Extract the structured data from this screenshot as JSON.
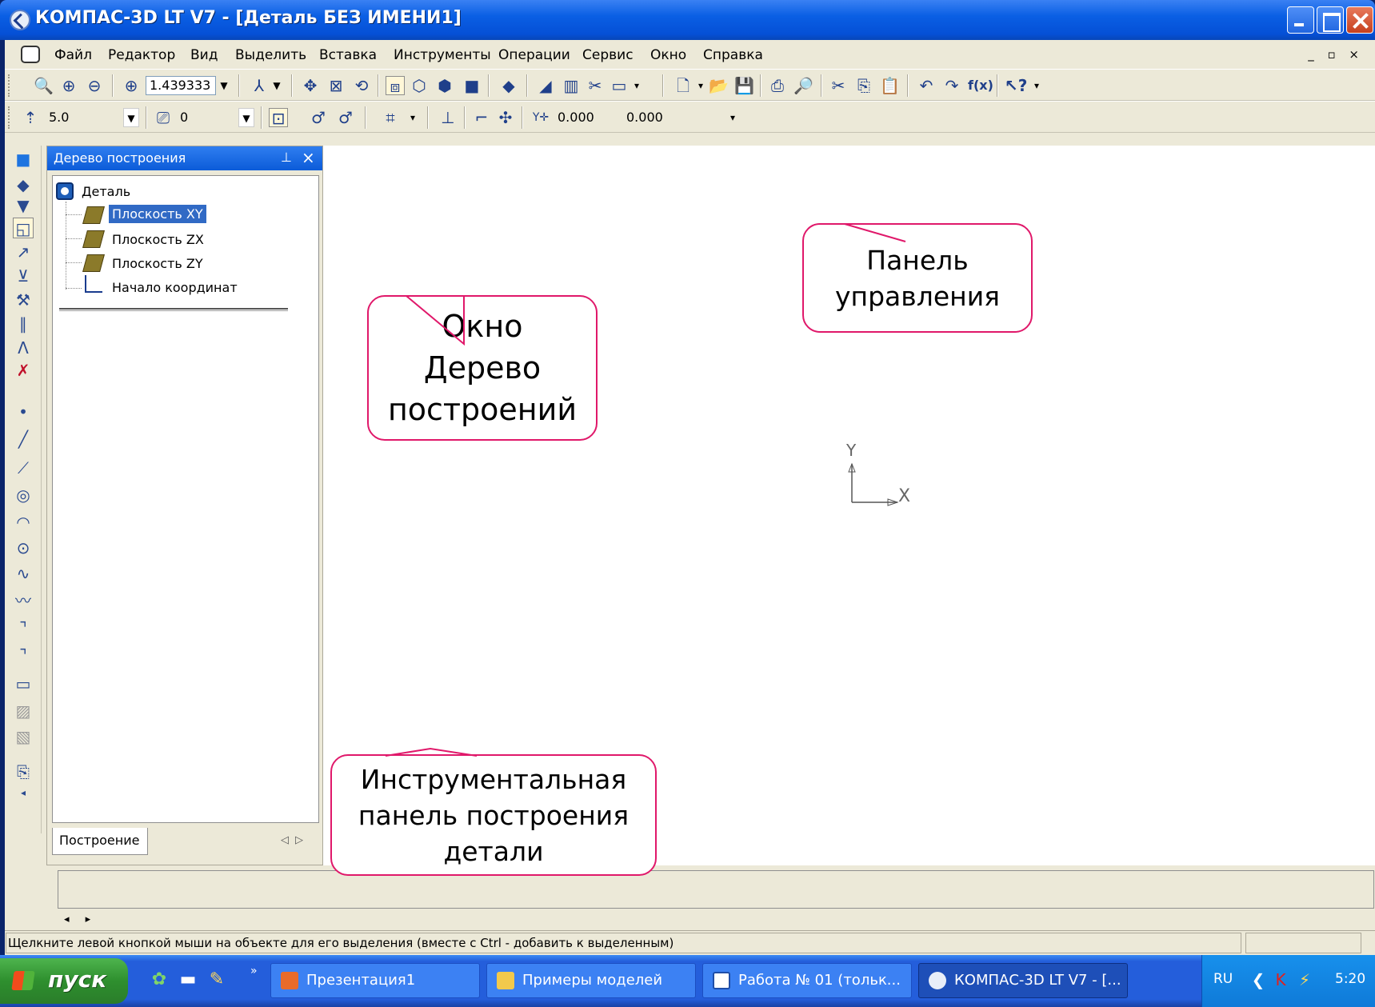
{
  "window": {
    "title": "КОМПАС-3D LT V7 - [Деталь БЕЗ ИМЕНИ1]"
  },
  "menu": {
    "items": [
      "Файл",
      "Редактор",
      "Вид",
      "Выделить",
      "Вставка",
      "Инструменты",
      "Операции",
      "Сервис",
      "Окно",
      "Справка"
    ],
    "right_controls": "_ ♬ ×"
  },
  "toolbar": {
    "zoom_value": "1.439333",
    "step_value": "5.0",
    "layer_value": "0",
    "coord_x": "0.000",
    "coord_y": "0.000",
    "fx_label": "f(x)"
  },
  "tree": {
    "panel_title": "Дерево построения",
    "root": "Деталь",
    "nodes": [
      "Плоскость XY",
      "Плоскость ZX",
      "Плоскость ZY",
      "Начало координат"
    ],
    "selected_index": 0,
    "tab_label": "Построение"
  },
  "canvas": {
    "axis_y": "Y",
    "axis_x": "X"
  },
  "callouts": {
    "control_panel": [
      "Панель",
      "управления"
    ],
    "tree_window": [
      "Окно",
      "Дерево",
      "построений"
    ],
    "tool_panel": [
      "Инструментальная",
      "панель построения",
      "детали"
    ],
    "border_color": "#e0186a"
  },
  "status": {
    "text": "Щелкните левой кнопкой мыши на объекте для его выделения (вместе с Ctrl - добавить к выделенным)"
  },
  "taskbar": {
    "start_label": "пуск",
    "buttons": [
      "Презентация1",
      "Примеры моделей",
      "Работа № 01 (тольк...",
      "КОМПАС-3D LT V7 - [..."
    ],
    "active_index": 3,
    "lang": "RU",
    "clock": "5:20"
  },
  "colors": {
    "title_blue": "#0550d6",
    "selection": "#316ac5",
    "taskbar": "#245edb",
    "start_green": "#2e8f2e"
  }
}
